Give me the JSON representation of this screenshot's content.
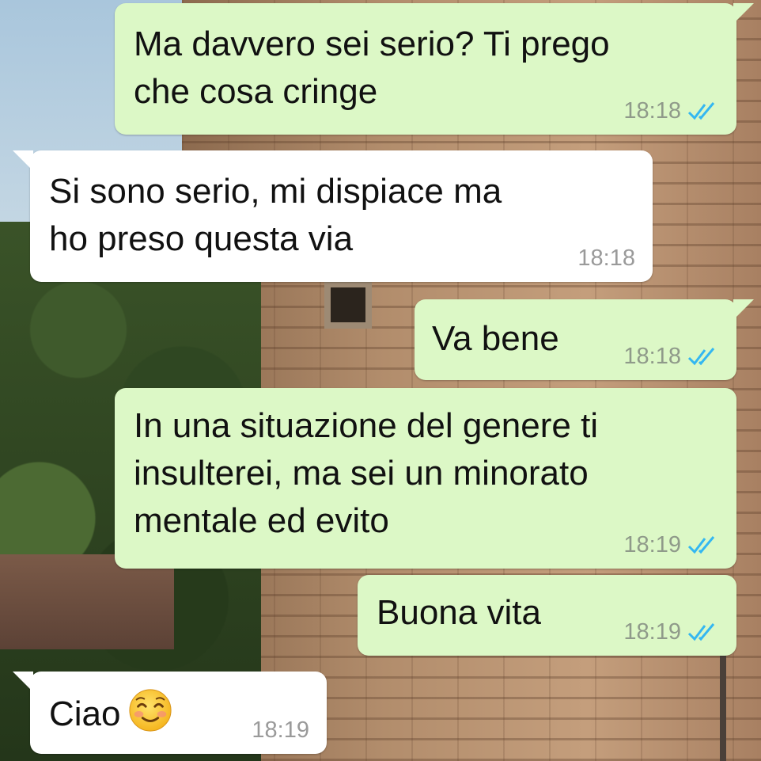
{
  "background": {
    "description_icon": "photo-wallpaper-icon"
  },
  "colors": {
    "outgoing_bubble": "#dcf8c6",
    "incoming_bubble": "#ffffff",
    "read_ticks": "#34b7f1",
    "timestamp": "#8f9a8a"
  },
  "messages": [
    {
      "direction": "outgoing",
      "text": "Ma davvero sei serio? Ti prego\nche cosa cringe",
      "time": "18:18",
      "status": "read"
    },
    {
      "direction": "incoming",
      "text": "Si sono serio, mi dispiace ma\nho preso questa via",
      "time": "18:18"
    },
    {
      "direction": "outgoing",
      "text": "Va bene",
      "time": "18:18",
      "status": "read"
    },
    {
      "direction": "outgoing",
      "text": "In una situazione del genere ti\ninsulterei, ma sei un minorato\nmentale ed evito",
      "time": "18:19",
      "status": "read"
    },
    {
      "direction": "outgoing",
      "text": "Buona vita",
      "time": "18:19",
      "status": "read"
    },
    {
      "direction": "incoming",
      "text": "Ciao",
      "time": "18:19",
      "emoji": "smiling-face-icon"
    }
  ]
}
